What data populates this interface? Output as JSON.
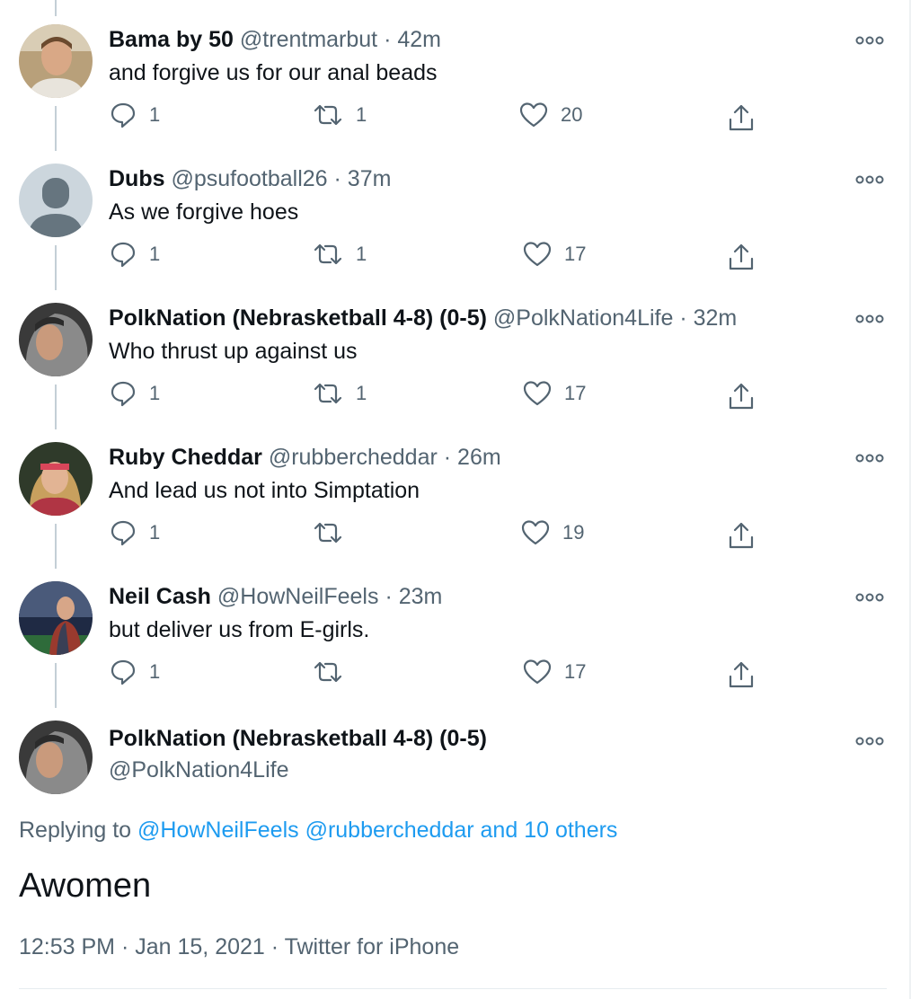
{
  "tweets": [
    {
      "name": "Bama by 50",
      "handle": "@trentmarbut",
      "time": "42m",
      "text": "and forgive us for our anal beads",
      "replies": "1",
      "retweets": "1",
      "likes": "20"
    },
    {
      "name": "Dubs",
      "handle": "@psufootball26",
      "time": "37m",
      "text": "As we forgive hoes",
      "replies": "1",
      "retweets": "1",
      "likes": "17"
    },
    {
      "name": "PolkNation (Nebrasketball 4-8) (0-5)",
      "handle": "@PolkNation4Life",
      "time": "32m",
      "text": "Who thrust up against us",
      "replies": "1",
      "retweets": "1",
      "likes": "17"
    },
    {
      "name": "Ruby Cheddar",
      "handle": "@rubbercheddar",
      "time": "26m",
      "text": "And lead us not into Simptation",
      "replies": "1",
      "retweets": "",
      "likes": "19"
    },
    {
      "name": "Neil Cash",
      "handle": "@HowNeilFeels",
      "time": "23m",
      "text": "but deliver us from E-girls.",
      "replies": "1",
      "retweets": "",
      "likes": "17"
    }
  ],
  "separator": "·",
  "main_tweet": {
    "name": "PolkNation (Nebrasketball 4-8) (0-5)",
    "handle": "@PolkNation4Life",
    "replying_prefix": "Replying to",
    "replying_user1": "@HowNeilFeels",
    "replying_user2": "@rubbercheddar",
    "replying_others": "and 10 others",
    "text": "Awomen",
    "time": "12:53 PM",
    "date": "Jan 15, 2021",
    "source": "Twitter for iPhone"
  },
  "icons": [
    "more-icon",
    "reply-icon",
    "retweet-icon",
    "like-icon",
    "share-icon"
  ],
  "colors": {
    "link": "#1d9bf0",
    "secondary": "#536471",
    "text": "#0f1419"
  }
}
